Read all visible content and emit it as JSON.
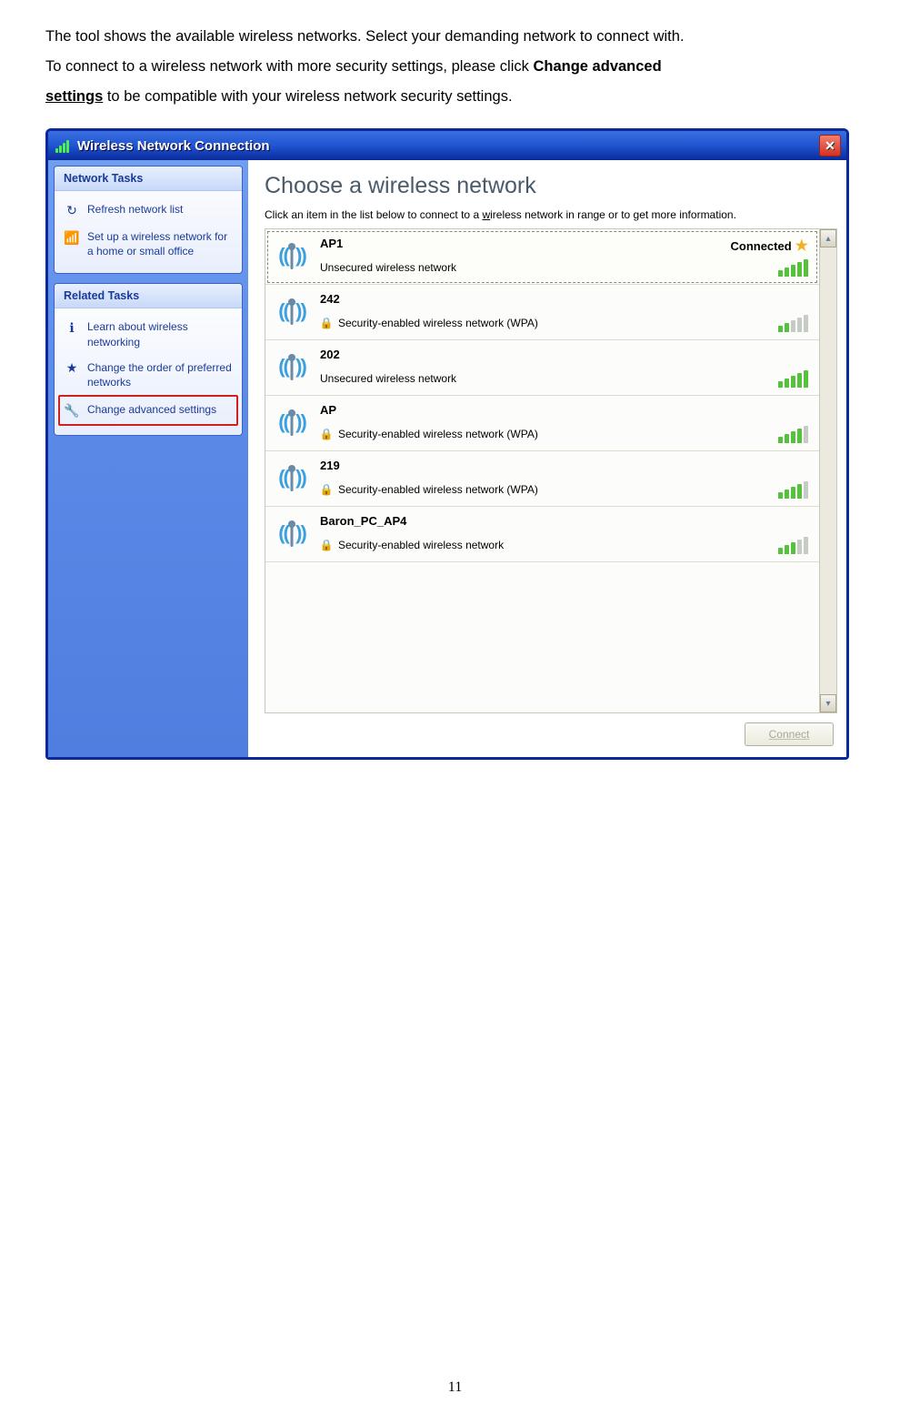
{
  "intro": {
    "line1": "The tool shows the available wireless networks. Select your demanding network to connect with.",
    "line2_pre": "To connect to a wireless network with more security settings, please click ",
    "line2_bold": "Change advanced",
    "line3_bold": "settings",
    "line3_post": " to be compatible with your wireless network security settings."
  },
  "window": {
    "title": "Wireless Network Connection"
  },
  "sidebar": {
    "tasks_title": "Network Tasks",
    "tasks": [
      {
        "label": "Refresh network list",
        "icon": "↻",
        "icon_name": "refresh-icon"
      },
      {
        "label": "Set up a wireless network for a home or small office",
        "icon": "📶",
        "icon_name": "setup-network-icon"
      }
    ],
    "related_title": "Related Tasks",
    "related": [
      {
        "label": "Learn about wireless networking",
        "icon": "ℹ",
        "icon_name": "info-icon",
        "highlight": false
      },
      {
        "label": "Change the order of preferred networks",
        "icon": "★",
        "icon_name": "star-icon",
        "highlight": false
      },
      {
        "label": "Change advanced settings",
        "icon": "🔧",
        "icon_name": "wrench-icon",
        "highlight": true
      }
    ]
  },
  "main": {
    "heading": "Choose a wireless network",
    "instruction_pre": "Click an item in the list below to connect to a ",
    "instruction_u": "w",
    "instruction_post": "ireless network in range or to get more information.",
    "connect_label": "Connect"
  },
  "networks": [
    {
      "name": "AP1",
      "security": "Unsecured wireless network",
      "locked": false,
      "status": "Connected",
      "star": true,
      "signal": 5,
      "selected": true
    },
    {
      "name": "242",
      "security": "Security-enabled wireless network (WPA)",
      "locked": true,
      "status": "",
      "star": false,
      "signal": 2,
      "selected": false
    },
    {
      "name": "202",
      "security": "Unsecured wireless network",
      "locked": false,
      "status": "",
      "star": false,
      "signal": 5,
      "selected": false
    },
    {
      "name": "AP",
      "security": "Security-enabled wireless network (WPA)",
      "locked": true,
      "status": "",
      "star": false,
      "signal": 4,
      "selected": false
    },
    {
      "name": "219",
      "security": "Security-enabled wireless network (WPA)",
      "locked": true,
      "status": "",
      "star": false,
      "signal": 4,
      "selected": false
    },
    {
      "name": "Baron_PC_AP4",
      "security": "Security-enabled wireless network",
      "locked": true,
      "status": "",
      "star": false,
      "signal": 3,
      "selected": false
    }
  ],
  "page_number": "11"
}
